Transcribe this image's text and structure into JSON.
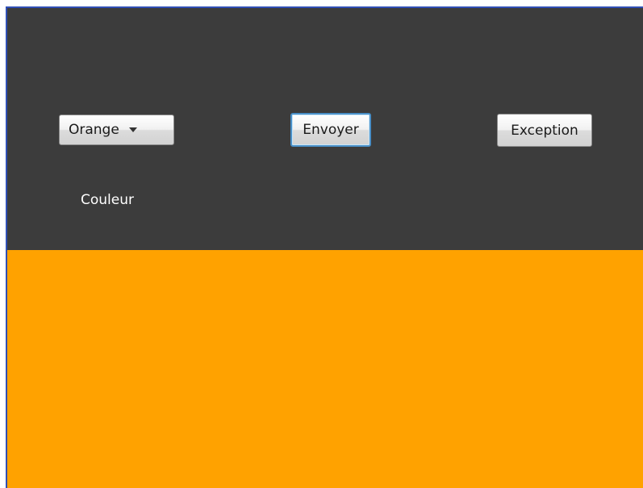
{
  "controls": {
    "color_select": {
      "selected": "Orange"
    },
    "send_button_label": "Envoyer",
    "exception_button_label": "Exception",
    "color_label": "Couleur"
  },
  "colors": {
    "panel_background": "#3c3c3c",
    "selected_fill": "#ffa200",
    "frame_border": "#2f4fb5",
    "focus_border": "#4a90c8"
  },
  "icons": {
    "combo_arrow": "triangle-down-icon"
  }
}
